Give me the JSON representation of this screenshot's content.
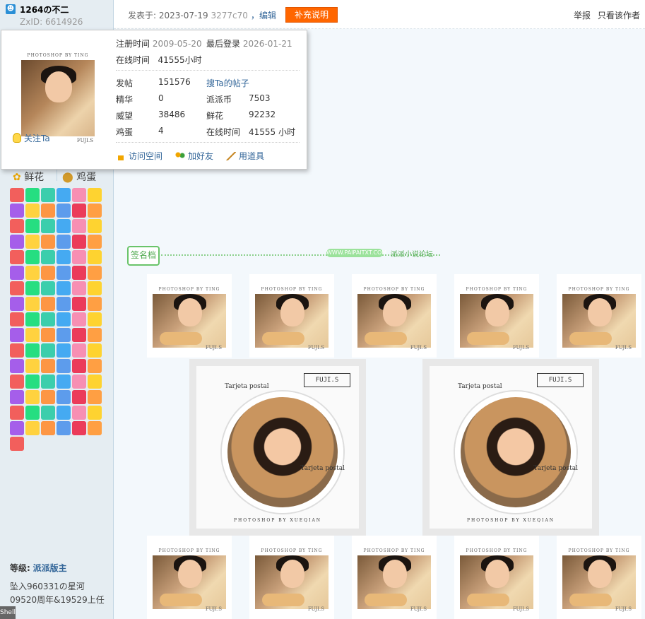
{
  "user": {
    "name": "1264の不二",
    "zxid": "ZxID:  6614926",
    "follow": "关注Ta",
    "gifts": [
      "鲜花",
      "鸡蛋"
    ],
    "level_label": "等级:",
    "level_value": "派派版主",
    "custom_title": "坠入960331の星河　09520周年&19529上任"
  },
  "popup": {
    "avatar_header": "PHOTOSHOP BY TING",
    "avatar_footer": "FUJI.S",
    "reg_label": "注册时间",
    "reg_value": "2009-05-20",
    "last_label": "最后登录",
    "last_value": "2026-01-21",
    "online_label": "在线时间",
    "online_value": "41555小时",
    "stats": [
      {
        "k": "发帖",
        "v": "151576"
      },
      {
        "k": "精华",
        "v": "0"
      },
      {
        "k": "威望",
        "v": "38486"
      },
      {
        "k": "鸡蛋",
        "v": "4"
      }
    ],
    "stats2": [
      {
        "k": "派派币",
        "v": "7503"
      },
      {
        "k": "鲜花",
        "v": "92232"
      },
      {
        "k": "在线时间",
        "v": "41555 小时"
      }
    ],
    "search_posts": "搜Ta的帖子",
    "actions": [
      "访问空间",
      "加好友",
      "用道具"
    ]
  },
  "post": {
    "date_prefix": "发表于: 2023-07-19",
    "post_id": "3277c70",
    "edit": "，编辑",
    "supplement": "补充说明",
    "report": "举报",
    "author_only": "只看该作者"
  },
  "signature": {
    "badge": "签名档",
    "site": "WWW.PAIPAITXT.COM",
    "forum": "派派小说论坛"
  },
  "thumb_header": "PHOTOSHOP BY TING",
  "thumb_footer": "FUJI.S",
  "big_card": {
    "tl": "Tarjeta postal",
    "tr": "FUJI.S",
    "r": "Tarjeta postal",
    "b": "PHOTOSHOP BY XUEQIAN"
  },
  "footer_strip": "Shell",
  "colors": {
    "accent_link": "#336699",
    "button_orange": "#ff6600",
    "sidebar_bg": "#e5edf2"
  }
}
